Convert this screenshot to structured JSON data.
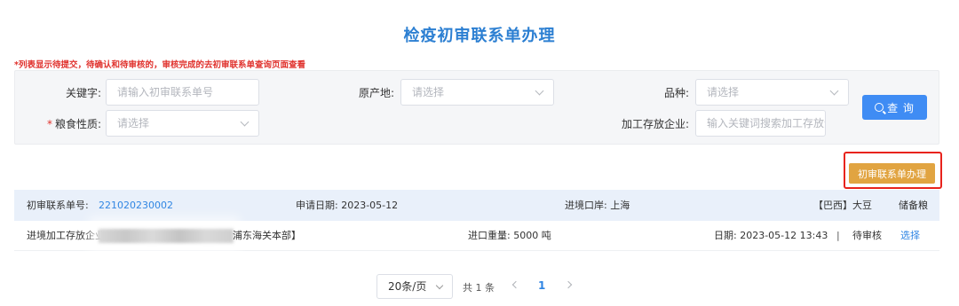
{
  "page": {
    "title": "检疫初审联系单办理"
  },
  "notice": "*列表显示待提交，待确认和待审核的，审核完成的去初审联系单查询页面查看",
  "filters": {
    "keyword": {
      "label": "关键字:",
      "placeholder": "请输入初审联系单号"
    },
    "origin": {
      "label": "原产地:",
      "placeholder": "请选择"
    },
    "variety": {
      "label": "品种:",
      "placeholder": "请选择"
    },
    "grain_nature": {
      "required_mark": "*",
      "label": "粮食性质:",
      "placeholder": "请选择"
    },
    "storage_company": {
      "label": "加工存放企业:",
      "placeholder": "输入关键词搜索加工存放企业"
    },
    "query_button": "查 询"
  },
  "actions": {
    "handle_button": "初审联系单办理"
  },
  "records": [
    {
      "no_label": "初审联系单号:",
      "no_value": "221020230002",
      "apply_date": "申请日期: 2023-05-12",
      "entry_port": "进境口岸: 上海",
      "country_variety": "【巴西】大豆",
      "category": "储备粮",
      "company_prefix": "进境加工存放企业",
      "company_suffix": "浦东海关本部】",
      "import_weight": "进口重量: 5000 吨",
      "date_time": "日期: 2023-05-12 13:43",
      "separator": "|",
      "status": "待审核",
      "select_link": "选择"
    }
  ],
  "pagination": {
    "page_size": "20条/页",
    "total": "共 1 条",
    "current_page": "1"
  },
  "colors": {
    "accent": "#2f85e3",
    "primary_button": "#3f8cf4",
    "warning_button": "#e1a441",
    "highlight_border": "#e8231c",
    "notice_text": "#e0322d"
  }
}
